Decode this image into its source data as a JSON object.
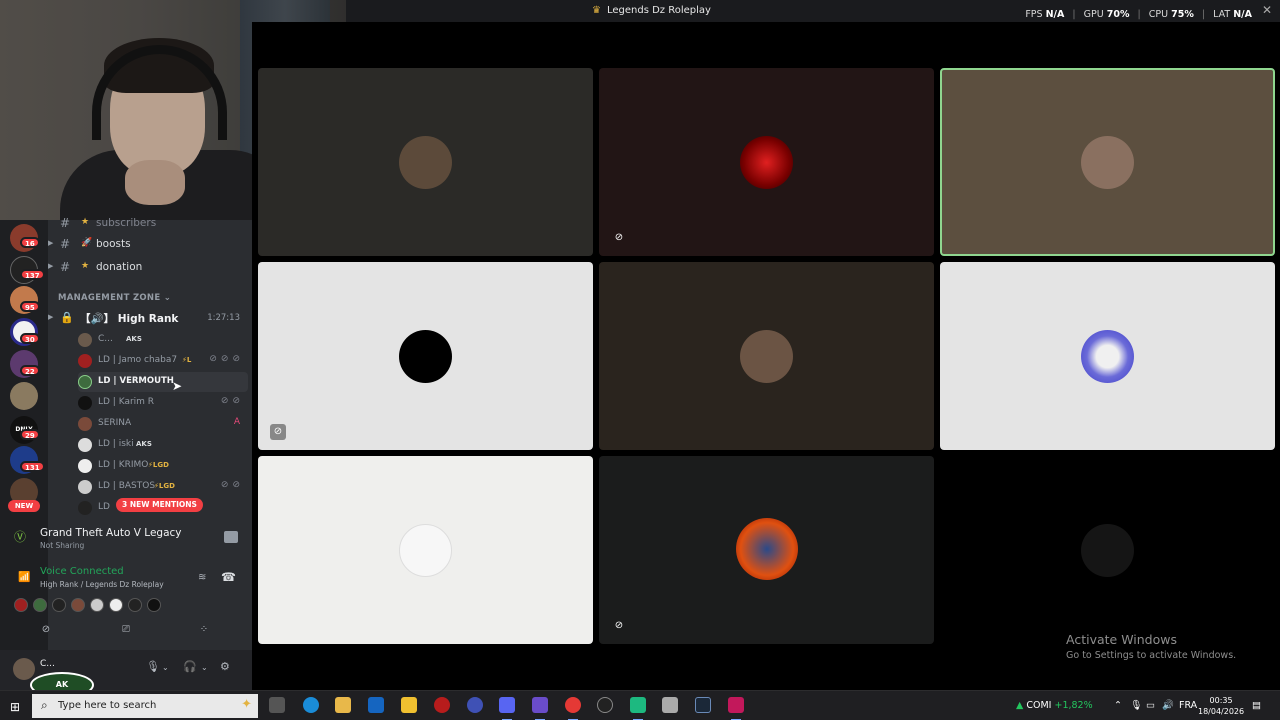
{
  "window": {
    "title": "Legends Dz Roleplay",
    "perf": {
      "fps_label": "FPS",
      "fps_value": "N/A",
      "gpu_label": "GPU",
      "gpu_value": "70%",
      "cpu_label": "CPU",
      "cpu_value": "75%",
      "lat_label": "LAT",
      "lat_value": "N/A"
    }
  },
  "guilds": {
    "badges": [
      "16",
      "137",
      "95",
      "30",
      "22",
      "29",
      "131"
    ],
    "new_label": "NEW",
    "logo_text": "DNLY"
  },
  "channels": {
    "items": [
      {
        "name": "subscribers",
        "emoji": "★"
      },
      {
        "name": "boosts",
        "emoji": "🚀"
      },
      {
        "name": "donation",
        "emoji": "★"
      }
    ],
    "category": "MANAGEMENT ZONE",
    "voice_channel": {
      "name": "High Rank",
      "prefix": "【🔊】",
      "time": "1:27:13"
    },
    "members": [
      {
        "name": "C...",
        "tag": "AKS"
      },
      {
        "name": "LD | Jamo chaba7",
        "tag": "⚡L"
      },
      {
        "name": "LD | VERMOUTH",
        "tag": ""
      },
      {
        "name": "LD | Karim R",
        "tag": ""
      },
      {
        "name": "SERINA",
        "tag": ""
      },
      {
        "name": "LD | iski",
        "tag": "AKS"
      },
      {
        "name": "LD | KRIMO",
        "tag": "⚡LGD"
      },
      {
        "name": "LD | BASTOS",
        "tag": "⚡LGD"
      },
      {
        "name": "LD",
        "tag": ""
      }
    ],
    "mentions_pill": "3 NEW MENTIONS"
  },
  "activity": {
    "game": "Grand Theft Auto V Legacy",
    "status": "Not Sharing"
  },
  "voice": {
    "status": "Voice Connected",
    "location": "High Rank / Legends Dz Roleplay"
  },
  "user": {
    "name": "C...",
    "logo_text": "AK"
  },
  "watermark": {
    "line1": "Activate Windows",
    "line2": "Go to Settings to activate Windows."
  },
  "taskbar": {
    "search_placeholder": "Type here to search",
    "stock_name": "COMI",
    "stock_change": "+1,82%",
    "lang": "FRA",
    "time": "00:35",
    "date": "18/04/2026"
  },
  "colors": {
    "speaking_border": "#8fd68f",
    "voice_green": "#23a55a",
    "mention_red": "#f23f43"
  }
}
